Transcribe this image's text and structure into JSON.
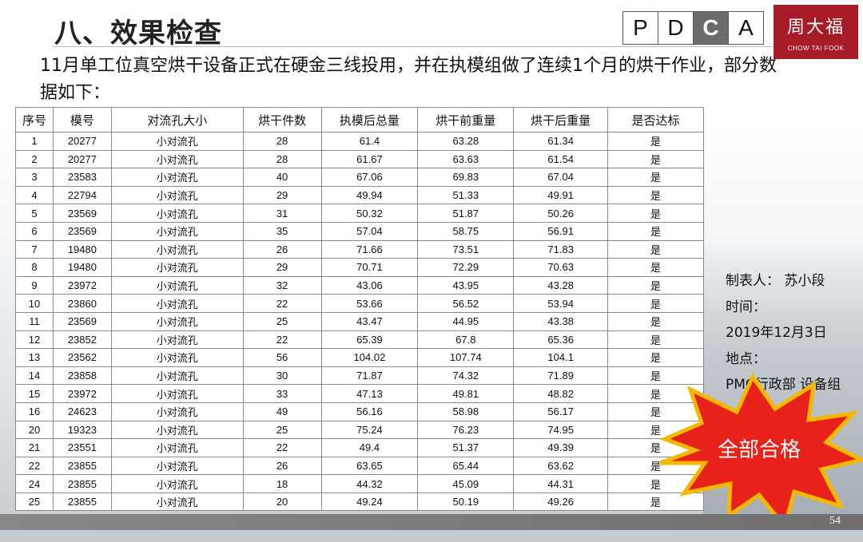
{
  "slide": {
    "title": "八、效果检查",
    "subtitle": "11月单工位真空烘干设备正式在硬金三线投用，并在执模组做了连续1个月的烘干作业，部分数据如下：",
    "page_number": "54"
  },
  "pdca": {
    "items": [
      "P",
      "D",
      "C",
      "A"
    ],
    "active": "C",
    "active_color": "#6b6b6b"
  },
  "logo": {
    "cn": "周大福",
    "en": "CHOW TAI FOOK",
    "color": "#a71b26"
  },
  "table": {
    "headers": [
      "序号",
      "模号",
      "对流孔大小",
      "烘干件数",
      "执模后总量",
      "烘干前重量",
      "烘干后重量",
      "是否达标"
    ],
    "rows": [
      [
        "1",
        "20277",
        "小对流孔",
        "28",
        "61.4",
        "63.28",
        "61.34",
        "是"
      ],
      [
        "2",
        "20277",
        "小对流孔",
        "28",
        "61.67",
        "63.63",
        "61.54",
        "是"
      ],
      [
        "3",
        "23583",
        "小对流孔",
        "40",
        "67.06",
        "69.83",
        "67.04",
        "是"
      ],
      [
        "4",
        "22794",
        "小对流孔",
        "29",
        "49.94",
        "51.33",
        "49.91",
        "是"
      ],
      [
        "5",
        "23569",
        "小对流孔",
        "31",
        "50.32",
        "51.87",
        "50.26",
        "是"
      ],
      [
        "6",
        "23569",
        "小对流孔",
        "35",
        "57.04",
        "58.75",
        "56.91",
        "是"
      ],
      [
        "7",
        "19480",
        "小对流孔",
        "26",
        "71.66",
        "73.51",
        "71.83",
        "是"
      ],
      [
        "8",
        "19480",
        "小对流孔",
        "29",
        "70.71",
        "72.29",
        "70.63",
        "是"
      ],
      [
        "9",
        "23972",
        "小对流孔",
        "32",
        "43.06",
        "43.95",
        "43.28",
        "是"
      ],
      [
        "10",
        "23860",
        "小对流孔",
        "22",
        "53.66",
        "56.52",
        "53.94",
        "是"
      ],
      [
        "11",
        "23569",
        "小对流孔",
        "25",
        "43.47",
        "44.95",
        "43.38",
        "是"
      ],
      [
        "12",
        "23852",
        "小对流孔",
        "22",
        "65.39",
        "67.8",
        "65.36",
        "是"
      ],
      [
        "13",
        "23562",
        "小对流孔",
        "56",
        "104.02",
        "107.74",
        "104.1",
        "是"
      ],
      [
        "14",
        "23858",
        "小对流孔",
        "30",
        "71.87",
        "74.32",
        "71.89",
        "是"
      ],
      [
        "15",
        "23972",
        "小对流孔",
        "33",
        "47.13",
        "49.81",
        "48.82",
        "是"
      ],
      [
        "16",
        "24623",
        "小对流孔",
        "49",
        "56.16",
        "58.98",
        "56.17",
        "是"
      ],
      [
        "20",
        "19323",
        "小对流孔",
        "25",
        "75.24",
        "76.23",
        "74.95",
        "是"
      ],
      [
        "21",
        "23551",
        "小对流孔",
        "22",
        "49.4",
        "51.37",
        "49.39",
        "是"
      ],
      [
        "22",
        "23855",
        "小对流孔",
        "26",
        "63.65",
        "65.44",
        "63.62",
        "是"
      ],
      [
        "24",
        "23855",
        "小对流孔",
        "18",
        "44.32",
        "45.09",
        "44.31",
        "是"
      ],
      [
        "25",
        "23855",
        "小对流孔",
        "20",
        "49.24",
        "50.19",
        "49.26",
        "是"
      ]
    ]
  },
  "info": {
    "maker": "制表人：  苏小段",
    "time_label": "时间：",
    "time_value": "2019年12月3日",
    "place_label": "地点：",
    "place_value": "PMC行政部 设备组"
  },
  "badge": {
    "text": "全部合格",
    "color": "#e8221b",
    "outline_color": "#f6b800"
  }
}
